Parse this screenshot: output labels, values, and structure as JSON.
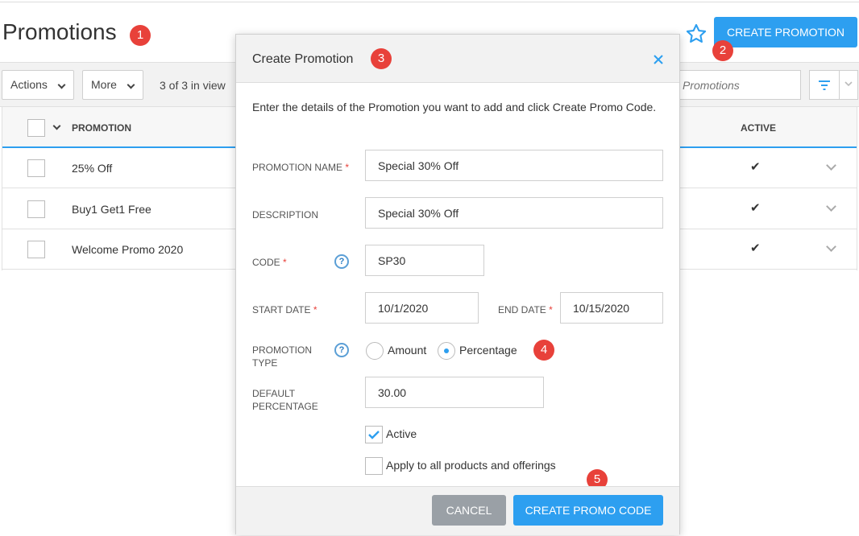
{
  "page": {
    "title": "Promotions",
    "create_button": "CREATE PROMOTION"
  },
  "toolbar": {
    "actions_label": "Actions",
    "more_label": "More",
    "count_text": "3 of 3 in view",
    "search_placeholder": "Promotions"
  },
  "table": {
    "columns": {
      "promotion": "PROMOTION",
      "active": "ACTIVE"
    },
    "rows": [
      {
        "name": "25% Off",
        "active": "✔"
      },
      {
        "name": "Buy1 Get1 Free",
        "active": "✔"
      },
      {
        "name": "Welcome Promo 2020",
        "active": "✔"
      }
    ]
  },
  "modal": {
    "title": "Create Promotion",
    "intro": "Enter the details of the Promotion you want to add and click Create Promo Code.",
    "labels": {
      "promotion_name": "PROMOTION NAME",
      "description": "DESCRIPTION",
      "code": "CODE",
      "start_date": "START DATE",
      "end_date": "END DATE",
      "promotion_type_1": "PROMOTION",
      "promotion_type_2": "TYPE",
      "default_percentage_1": "DEFAULT",
      "default_percentage_2": "PERCENTAGE"
    },
    "required_mark": "*",
    "help_glyph": "?",
    "values": {
      "promotion_name": "Special 30% Off",
      "description": "Special 30% Off",
      "code": "SP30",
      "start_date": "10/1/2020",
      "end_date": "10/15/2020",
      "default_percentage": "30.00"
    },
    "type_options": {
      "amount": "Amount",
      "percentage": "Percentage",
      "selected": "percentage"
    },
    "checkboxes": {
      "active_label": "Active",
      "active_checked": true,
      "apply_all_label": "Apply to all products and offerings",
      "apply_all_checked": false
    },
    "buttons": {
      "cancel": "CANCEL",
      "submit": "CREATE PROMO CODE"
    }
  },
  "callouts": [
    "1",
    "2",
    "3",
    "4",
    "5"
  ],
  "colors": {
    "accent": "#2d9ff0",
    "badge": "#e8413a",
    "cancel": "#9aa0a6"
  }
}
